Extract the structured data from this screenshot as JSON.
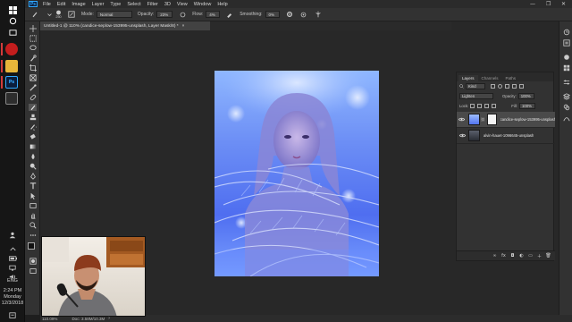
{
  "menu": {
    "logo": "Ps",
    "items": [
      "File",
      "Edit",
      "Image",
      "Layer",
      "Type",
      "Select",
      "Filter",
      "3D",
      "View",
      "Window",
      "Help"
    ],
    "win_min": "—",
    "win_max": "❐",
    "win_close": "✕"
  },
  "options": {
    "brush_size": "250",
    "mode_label": "Mode:",
    "mode_value": "Normal",
    "opacity_label": "Opacity:",
    "opacity_value": "23%",
    "flow_label": "Flow:",
    "flow_value": "4%",
    "smoothing_label": "Smoothing:",
    "smoothing_value": "0%"
  },
  "document": {
    "tab_title": "Untitled-1 @ 110% (candice-seplow-153995-unsplash, Layer Mask/8) *",
    "close": "×"
  },
  "layers_panel": {
    "tabs": [
      "Layers",
      "Channels",
      "Paths"
    ],
    "filter_kind": "Kind",
    "blend_mode": "Lighten",
    "opacity_label": "Opacity:",
    "opacity_value": "100%",
    "lock_label": "Lock:",
    "fill_label": "Fill:",
    "fill_value": "100%",
    "layers": [
      {
        "name": "candice-seplow-153995-unsplash",
        "selected": true,
        "has_mask": true
      },
      {
        "name": "alvin-hauet-1096645-unsplash",
        "selected": false,
        "has_mask": false
      }
    ]
  },
  "status": {
    "zoom": "110.09%",
    "doc": "Doc: 3.58M/10.3M"
  },
  "taskbar": {
    "lang": "ENG",
    "time": "2:24 PM",
    "day": "Monday",
    "date": "12/3/2018",
    "ps": "Ps"
  },
  "colors": {
    "accent": "#31a8ff",
    "selected_layer": "#4a4a4a"
  }
}
